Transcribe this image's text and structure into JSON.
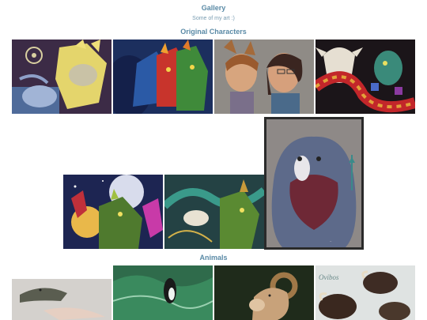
{
  "page": {
    "title": "Gallery",
    "subtitle": "Some of my art :)"
  },
  "sections": {
    "original_characters": "Original Characters",
    "animals": "Animals"
  },
  "gallery_row1": [
    {
      "name": "yellow-creature-painting",
      "bg": "#3a2a44",
      "accent": "#e8d66a"
    },
    {
      "name": "colorful-creatures-painting",
      "bg": "#1c2e5c",
      "accent": "#d43a2e"
    },
    {
      "name": "portrait-pair-painting",
      "bg": "#8e8a84",
      "accent": "#c79062"
    },
    {
      "name": "skull-serpent-painting",
      "bg": "#1a1418",
      "accent": "#c2262a"
    }
  ],
  "gallery_row2": [
    {
      "name": "moonlit-creatures-painting",
      "bg": "#1c2452",
      "accent": "#8ab04a"
    },
    {
      "name": "green-serpent-painting",
      "bg": "#234042",
      "accent": "#6e9a3c"
    },
    {
      "name": "blue-creature-portrait",
      "bg": "#8f8a88",
      "accent": "#7a2e3c"
    }
  ],
  "gallery_row3": [
    {
      "name": "alligator-painting",
      "bg": "#d5d2ce",
      "accent": "#5c5e52"
    },
    {
      "name": "ocean-orca-painting",
      "bg": "#2e6a4a",
      "accent": "#d8e8e0"
    },
    {
      "name": "ram-painting",
      "bg": "#1e2a1a",
      "accent": "#b08a5a"
    },
    {
      "name": "muskox-sketch",
      "bg": "#dfe3e2",
      "accent": "#3e2c24"
    }
  ],
  "signature": "Ovibos"
}
